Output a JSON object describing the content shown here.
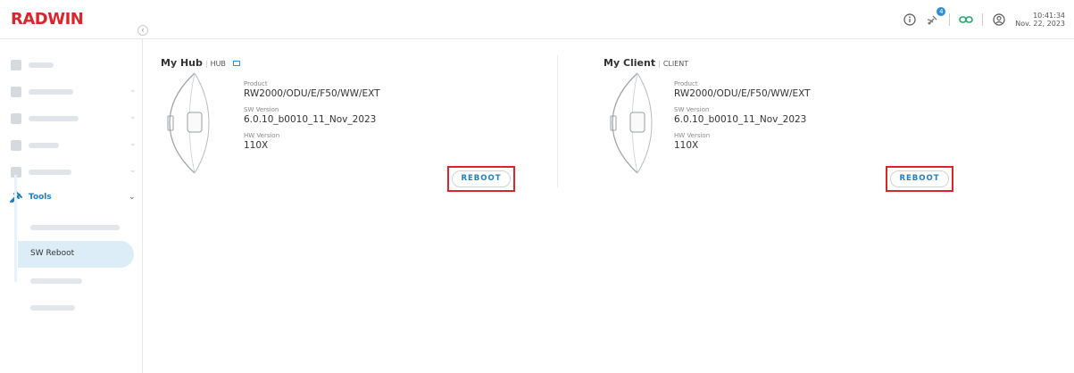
{
  "header": {
    "logo": "RADWIN",
    "notification_count": "4",
    "time": "10:41:34",
    "date": "Nov. 22, 2023"
  },
  "sidebar": {
    "collapse_glyph": "‹",
    "tools_label": "Tools",
    "active_sub_label": "SW Reboot"
  },
  "hub": {
    "name": "My Hub",
    "role": "HUB",
    "product_label": "Product",
    "product_value": "RW2000/ODU/E/F50/WW/EXT",
    "sw_label": "SW Version",
    "sw_value": "6.0.10_b0010_11_Nov_2023",
    "hw_label": "HW Version",
    "hw_value": "110X",
    "button": "REBOOT"
  },
  "client": {
    "name": "My Client",
    "role": "CLIENT",
    "product_label": "Product",
    "product_value": "RW2000/ODU/E/F50/WW/EXT",
    "sw_label": "SW Version",
    "sw_value": "6.0.10_b0010_11_Nov_2023",
    "hw_label": "HW Version",
    "hw_value": "110X",
    "button": "REBOOT"
  },
  "colors": {
    "brand": "#d8262c",
    "accent": "#1f7fc0",
    "highlight_box": "#d8262c"
  }
}
